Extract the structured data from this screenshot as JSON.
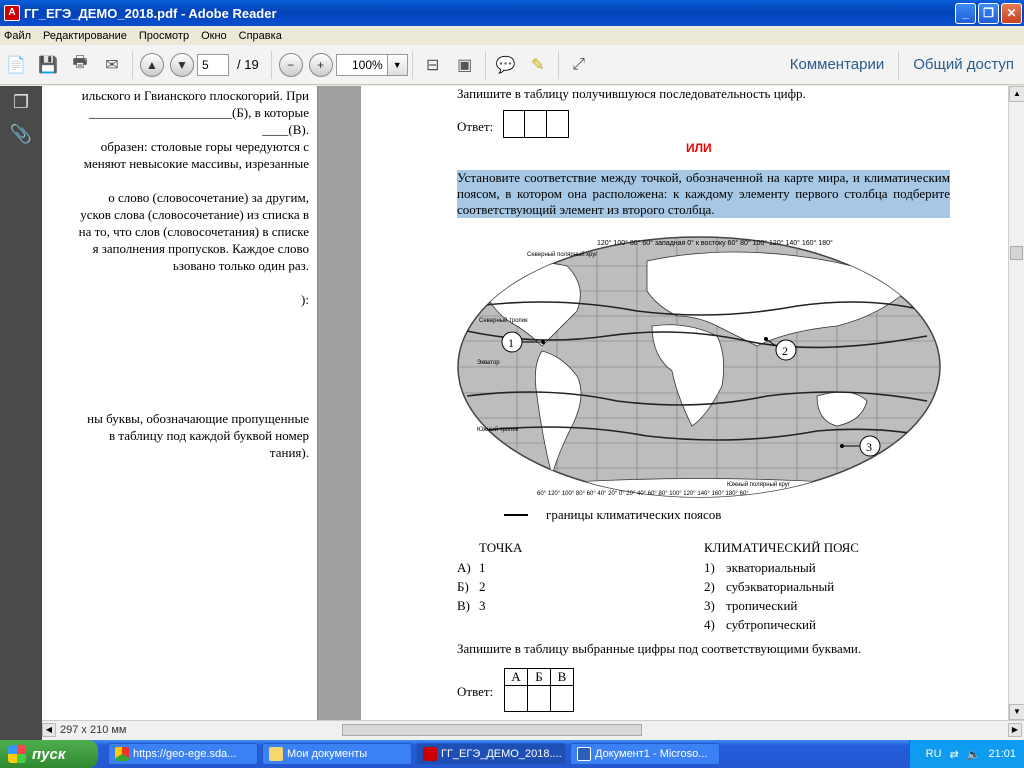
{
  "window": {
    "title": "ГГ_ЕГЭ_ДЕМО_2018.pdf - Adobe Reader",
    "app_icon": "pdf-icon"
  },
  "menu": [
    "Файл",
    "Редактирование",
    "Просмотр",
    "Окно",
    "Справка"
  ],
  "toolbar": {
    "page_current": "5",
    "page_total": "/ 19",
    "zoom": "100%",
    "comments_label": "Комментарии",
    "share_label": "Общий доступ"
  },
  "left_page_lines": [
    "ильского и Гвианского плоскогорий. При",
    "______________________(Б), в которые",
    "____(В).",
    "образен: столовые горы чередуются с",
    "меняют невысокие массивы, изрезанные",
    "",
    "о слово (словосочетание) за другим,",
    "усков слова (словосочетание) из списка в",
    "на то, что слов (словосочетания) в списке",
    "я заполнения пропусков. Каждое слово",
    "ьзовано только один раз.",
    "",
    "):",
    "",
    "",
    "",
    "",
    "",
    "",
    "ны буквы, обозначающие пропущенные",
    "в таблицу под каждой буквой номер",
    "тания)."
  ],
  "right_page": {
    "top_line": "Запишите в таблицу получившуюся последовательность цифр.",
    "answer_label": "Ответ:",
    "or_label": "ИЛИ",
    "task_text": "Установите соответствие между точкой, обозначенной на карте мира, и климатическим поясом, в котором она расположена: к каждому элементу первого столбца подберите соответствующий элемент из второго столбца.",
    "map_labels": {
      "top_longitudes": "120° 100° 80° 60° западная 0° к востоку 60° 80° 100° 120° 140° 160° 180°",
      "arctic": "Северный полярный круг",
      "tropic_n": "Северный тропик",
      "equator": "Экватор",
      "tropic_s": "Южный тропик",
      "antarctic": "Южный полярный круг",
      "bottom_longitudes": "60° 120° 100° 80° 60° 40° 20° 0° 20° 40° 60° 80° 100° 120° 140° 160° 180° 60°",
      "points": [
        "1",
        "2",
        "3"
      ]
    },
    "legend": "границы климатических поясов",
    "col1_header": "ТОЧКА",
    "col2_header": "КЛИМАТИЧЕСКИЙ ПОЯС",
    "col1_items": [
      [
        "А)",
        "1"
      ],
      [
        "Б)",
        "2"
      ],
      [
        "В)",
        "3"
      ]
    ],
    "col2_items": [
      [
        "1)",
        "экваториальный"
      ],
      [
        "2)",
        "субэкваториальный"
      ],
      [
        "3)",
        "тропический"
      ],
      [
        "4)",
        "субтропический"
      ]
    ],
    "bottom_instruction": "Запишите в таблицу выбранные цифры под соответствующими буквами.",
    "answer_table_headers": [
      "А",
      "Б",
      "В"
    ]
  },
  "page_size": "297 x 210 мм",
  "taskbar": {
    "start": "пуск",
    "tasks": [
      "https://geo-ege.sda...",
      "Мои документы",
      "ГГ_ЕГЭ_ДЕМО_2018....",
      "Документ1 - Microso..."
    ],
    "lang": "RU",
    "time": "21:01"
  }
}
